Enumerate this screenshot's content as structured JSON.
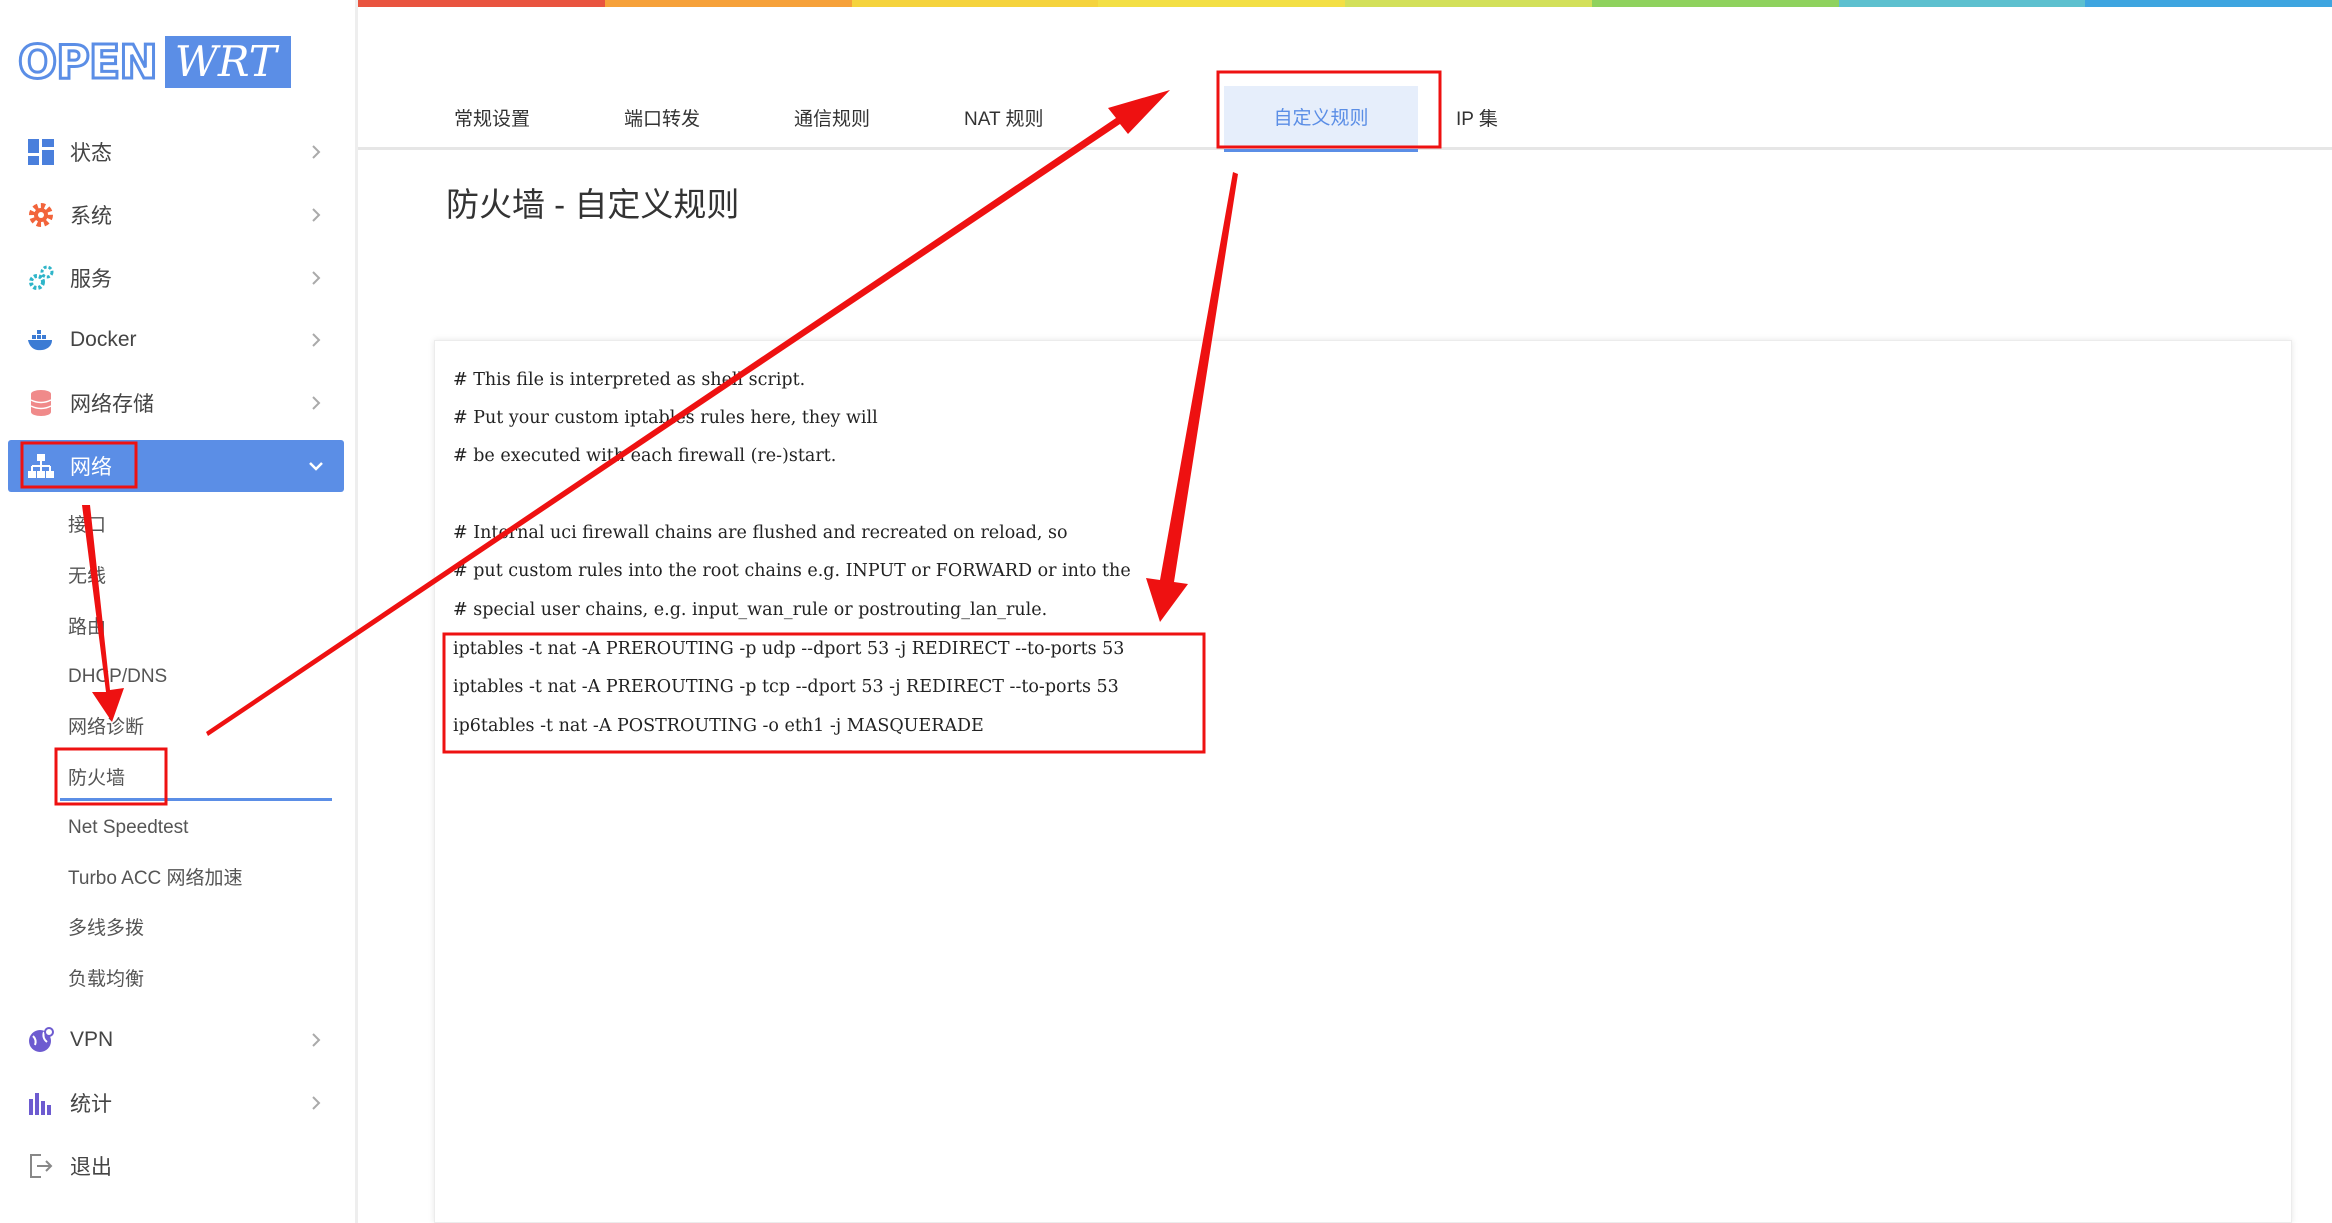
{
  "logo": {
    "open": "OPEN",
    "wrt": "WRT"
  },
  "sidebar": {
    "items": [
      {
        "label": "状态",
        "icon": "dashboard-icon"
      },
      {
        "label": "系统",
        "icon": "gear-icon"
      },
      {
        "label": "服务",
        "icon": "gears-icon"
      },
      {
        "label": "Docker",
        "icon": "docker-whale-icon"
      },
      {
        "label": "网络存储",
        "icon": "database-icon"
      },
      {
        "label": "网络",
        "icon": "network-icon",
        "active": true
      },
      {
        "label": "VPN",
        "icon": "vpn-globe-icon"
      },
      {
        "label": "统计",
        "icon": "bar-chart-icon"
      },
      {
        "label": "退出",
        "icon": "logout-icon"
      }
    ],
    "network_sub": [
      "接口",
      "无线",
      "路由",
      "DHCP/DNS",
      "网络诊断",
      "防火墙",
      "Net Speedtest",
      "Turbo ACC 网络加速",
      "多线多拨",
      "负载均衡"
    ]
  },
  "tabs": [
    "常规设置",
    "端口转发",
    "通信规则",
    "NAT 规则",
    "IP 集",
    "自定义规则"
  ],
  "page_title": "防火墙 - 自定义规则",
  "editor": {
    "lines": [
      "# This file is interpreted as shell script.",
      "# Put your custom iptables rules here, they will",
      "# be executed with each firewall (re-)start.",
      "",
      "# Internal uci firewall chains are flushed and recreated on reload, so",
      "# put custom rules into the root chains e.g. INPUT or FORWARD or into the",
      "# special user chains, e.g. input_wan_rule or postrouting_lan_rule.",
      "iptables -t nat -A PREROUTING -p udp --dport 53 -j REDIRECT --to-ports 53",
      "iptables -t nat -A PREROUTING -p tcp --dport 53 -j REDIRECT --to-ports 53",
      "ip6tables -t nat -A POSTROUTING -o eth1 -j MASQUERADE"
    ]
  },
  "colors": {
    "accent": "#5b8ee6",
    "annotation": "#ee1111",
    "rainbow": [
      "#e9543f",
      "#f6a13a",
      "#f5d33d",
      "#f3df45",
      "#d3e05a",
      "#8fd25e",
      "#5dc0cf",
      "#3ea5e0"
    ]
  }
}
